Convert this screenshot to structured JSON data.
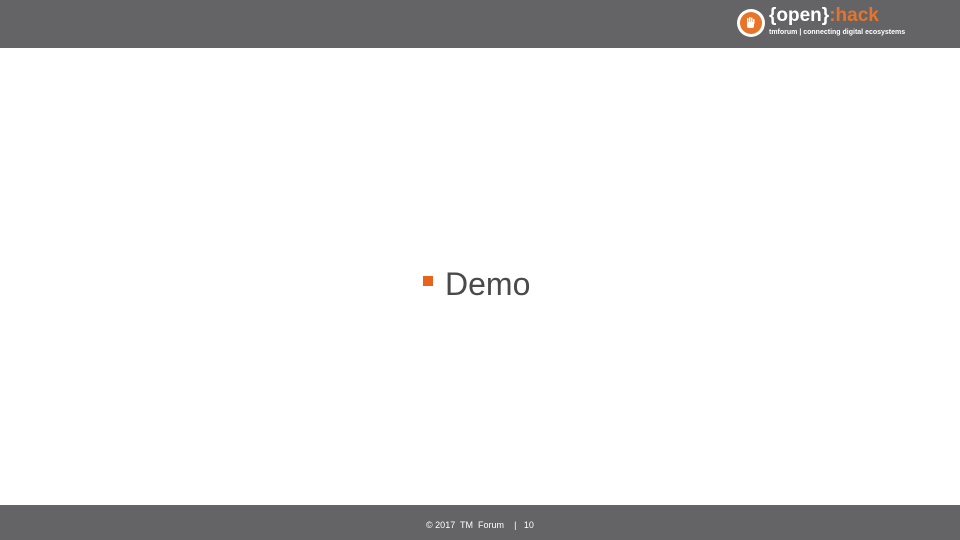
{
  "header": {
    "logo": {
      "word_open": "{open}",
      "word_hack": ":hack",
      "tagline": "tmforum | connecting digital ecosystems",
      "icon": "hand-badge-icon"
    }
  },
  "content": {
    "bullet_icon": "square-bullet-icon",
    "item": "Demo"
  },
  "footer": {
    "copyright": "© 2017  TM  Forum",
    "separator": "|",
    "page_number": "10"
  },
  "colors": {
    "bar": "#646466",
    "accent": "#e8742a",
    "bullet": "#e8631c",
    "text": "#4a4a4a",
    "background": "#ffffff"
  }
}
